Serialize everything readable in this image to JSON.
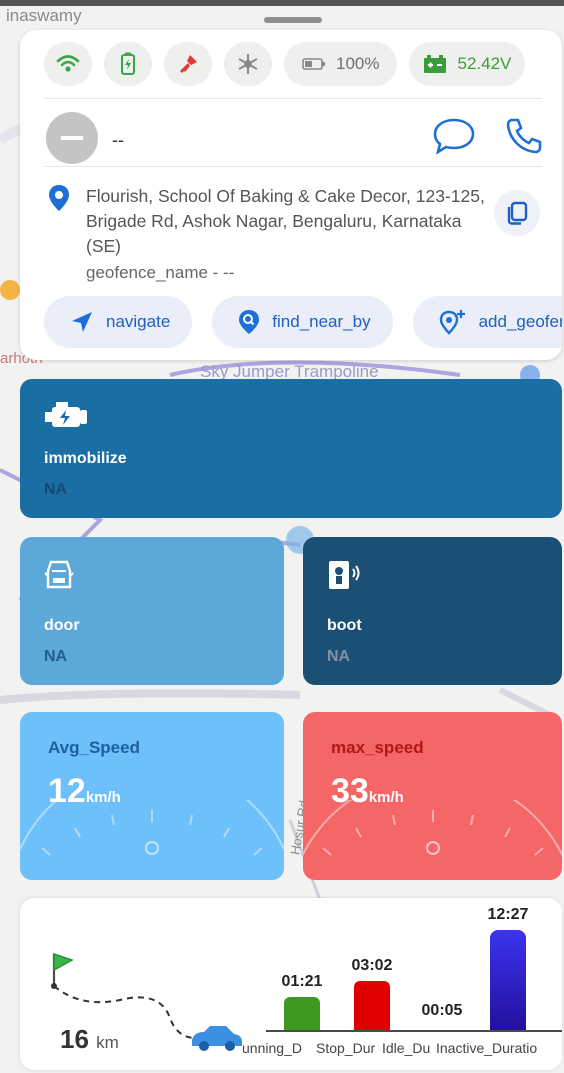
{
  "map": {
    "labels": [
      "inaswamy",
      "Sky Jumper Trampoline",
      "arhotn",
      "Hosur Rd"
    ]
  },
  "status_bar": {
    "icons": [
      "wifi-icon",
      "battery-charging-icon",
      "ignition-key-icon",
      "ac-fan-icon"
    ],
    "battery_percent": "100%",
    "voltage": "52.42V",
    "colors": {
      "wifi": "#3aa64a",
      "battery": "#3aa64a",
      "key": "#e53935",
      "fan": "#888888"
    }
  },
  "driver": {
    "name": "--"
  },
  "location": {
    "address": "Flourish, School Of Baking & Cake Decor, 123-125, Brigade Rd, Ashok Nagar, Bengaluru, Karnataka (SE)",
    "geofence": "geofence_name - --"
  },
  "actions": [
    {
      "label": "navigate",
      "icon": "navigate-arrow-icon"
    },
    {
      "label": "find_near_by",
      "icon": "location-search-icon"
    },
    {
      "label": "add_geofence",
      "icon": "add-location-icon"
    }
  ],
  "tiles": {
    "immobilize": {
      "label": "immobilize",
      "value": "NA",
      "color": "#1b6ea3"
    },
    "door": {
      "label": "door",
      "value": "NA",
      "color": "#5ba8d9"
    },
    "boot": {
      "label": "boot",
      "value": "NA",
      "color": "#1c4f74"
    }
  },
  "speed": {
    "avg": {
      "label": "Avg_Speed",
      "value": "12",
      "unit": "km/h",
      "color": "#6ec0fb"
    },
    "max": {
      "label": "max_speed",
      "value": "33",
      "unit": "km/h",
      "color": "#f56767"
    }
  },
  "trip": {
    "distance": "16",
    "distance_unit": "km"
  },
  "chart_data": {
    "type": "bar",
    "categories": [
      "Running_Duration",
      "Stop_Duration",
      "Idle_Duration",
      "Inactive_Duration"
    ],
    "values": [
      81,
      182,
      5,
      747
    ],
    "value_labels": [
      "01:21",
      "03:02",
      "00:05",
      "12:27"
    ],
    "colors": [
      "#3b9a1f",
      "#e00000",
      "#b0b0b0",
      "#2f1ee0"
    ],
    "category_labels_visible": [
      "unning_D",
      "Stop_Dur",
      "Idle_Du",
      "Inactive_Duratio"
    ]
  }
}
